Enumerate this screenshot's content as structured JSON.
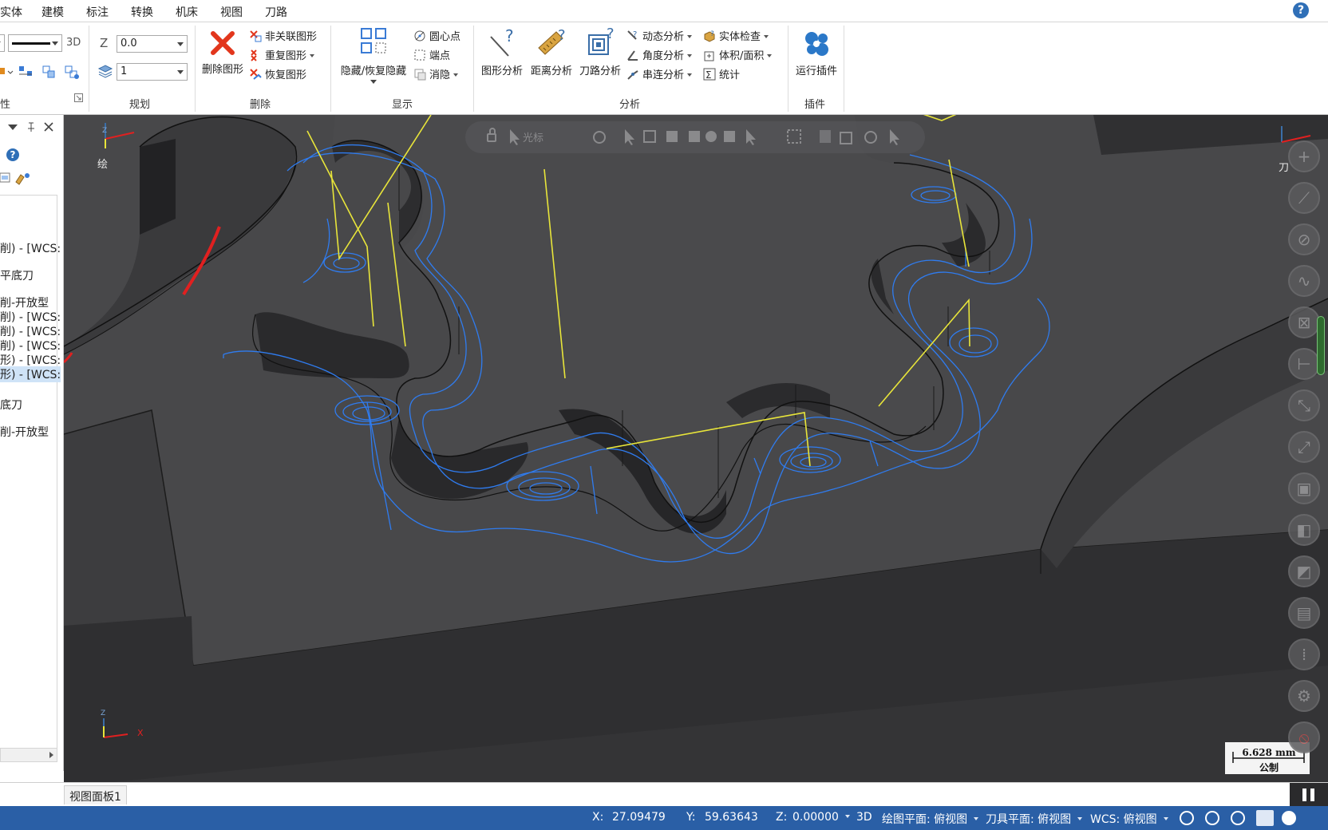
{
  "menu": {
    "items": [
      "实体",
      "建模",
      "标注",
      "转换",
      "机床",
      "视图",
      "刀路"
    ]
  },
  "ribbon": {
    "attr_group": {
      "line_3d": "3D",
      "label": "性"
    },
    "plan_group": {
      "z_label": "Z",
      "z_value": "0.0",
      "level_value": "1",
      "label": "规划"
    },
    "delete_group": {
      "delete_btn": "删除图形",
      "unassoc": "非关联图形",
      "duplicate": "重复图形",
      "restore": "恢复图形",
      "label": "删除"
    },
    "display_group": {
      "hide_btn": "隐藏/恢复隐藏",
      "center": "圆心点",
      "endpoint": "端点",
      "blank": "消隐",
      "label": "显示"
    },
    "analysis_group": {
      "shape_btn": "图形分析",
      "distance_btn": "距离分析",
      "toolpath_btn": "刀路分析",
      "dynamic": "动态分析",
      "angle": "角度分析",
      "chain": "串连分析",
      "solid_check": "实体检查",
      "volume": "体积/面积",
      "stats": "统计",
      "label": "分析"
    },
    "plugin_group": {
      "run_btn": "运行插件",
      "label": "插件"
    },
    "help_icon": "?"
  },
  "left_panel": {
    "items": [
      {
        "text": "削) - [WCS:",
        "selected": false
      },
      {
        "text": "平底刀",
        "selected": false
      },
      {
        "text": "削-开放型",
        "selected": false
      },
      {
        "text": "削) - [WCS:",
        "selected": false
      },
      {
        "text": "削) - [WCS:",
        "selected": false
      },
      {
        "text": "削) - [WCS:",
        "selected": false
      },
      {
        "text": "形) - [WCS:",
        "selected": false
      },
      {
        "text": "形) - [WCS:",
        "selected": true
      },
      {
        "text": "底刀",
        "selected": false
      },
      {
        "text": "削-开放型",
        "selected": false
      }
    ]
  },
  "viewport": {
    "top_left_label": "绘",
    "top_right_label": "刀",
    "axis_x": "X",
    "axis_z": "Z",
    "scale_value": "6.628 mm",
    "scale_unit": "公制",
    "floatbar_text": "光标"
  },
  "bottom": {
    "tab": "视图面板1"
  },
  "status": {
    "x_label": "X:",
    "x_value": "27.09479",
    "y_label": "Y:",
    "y_value": "59.63643",
    "z_label": "Z:",
    "z_value": "0.00000",
    "mode": "3D",
    "cplane": "绘图平面: 俯视图",
    "tplane": "刀具平面: 俯视图",
    "wcs": "WCS: 俯视图"
  },
  "colors": {
    "status_bar": "#2a5fa6",
    "viewport_bg": "#3d3d3f",
    "toolpath_blue": "#2f7cf0",
    "rapid_yellow": "#e8e53a",
    "selected_red": "#e02020"
  }
}
